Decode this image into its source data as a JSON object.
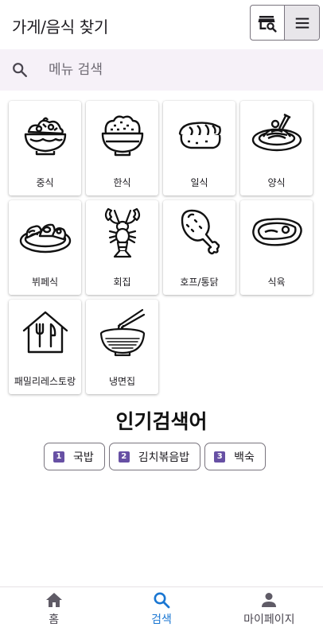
{
  "app_bar": {
    "title": "가게/음식 찾기",
    "toggle_buttons": [
      {
        "icon": "store-search-icon",
        "selected": false
      },
      {
        "icon": "menu-icon",
        "selected": true
      }
    ]
  },
  "search": {
    "placeholder": "메뉴 검색",
    "value": "",
    "icon": "search-icon"
  },
  "categories": [
    {
      "label": "중식",
      "icon": "chinese-food-icon"
    },
    {
      "label": "한식",
      "icon": "rice-bowl-icon"
    },
    {
      "label": "일식",
      "icon": "sushi-icon"
    },
    {
      "label": "양식",
      "icon": "pasta-icon"
    },
    {
      "label": "뷔페식",
      "icon": "buffet-platter-icon"
    },
    {
      "label": "회집",
      "icon": "lobster-icon"
    },
    {
      "label": "호프/통닭",
      "icon": "chicken-leg-icon"
    },
    {
      "label": "식육",
      "icon": "steak-icon"
    },
    {
      "label": "패밀리레스토랑",
      "icon": "family-restaurant-icon"
    },
    {
      "label": "냉면집",
      "icon": "noodle-bowl-icon"
    }
  ],
  "popular": {
    "title": "인기검색어",
    "items": [
      {
        "rank": "1",
        "label": "국밥"
      },
      {
        "rank": "2",
        "label": "김치볶음밥"
      },
      {
        "rank": "3",
        "label": "백숙"
      }
    ]
  },
  "bottom_nav": [
    {
      "label": "홈",
      "icon": "home-icon",
      "active": false
    },
    {
      "label": "검색",
      "icon": "search-icon",
      "active": true
    },
    {
      "label": "마이페이지",
      "icon": "person-icon",
      "active": false
    }
  ],
  "colors": {
    "accent": "#1976d2",
    "badge": "#6750a4",
    "search_bg": "#f6f1f8"
  }
}
